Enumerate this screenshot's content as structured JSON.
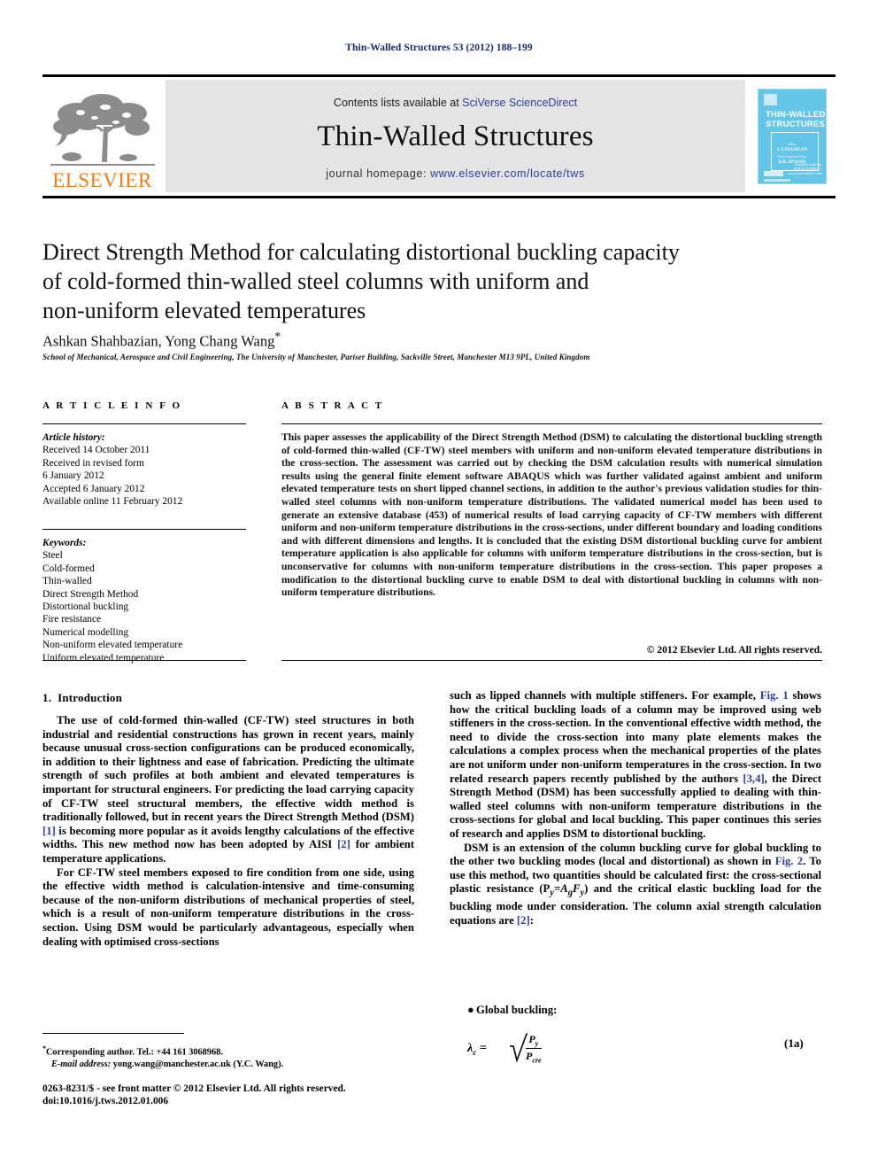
{
  "running_head": "Thin-Walled Structures 53 (2012) 188–199",
  "masthead": {
    "publisher_name": "ELSEVIER",
    "contents_prefix": "Contents lists available at ",
    "contents_link": "SciVerse ScienceDirect",
    "journal_title": "Thin-Walled Structures",
    "homepage_prefix": "journal homepage: ",
    "homepage_url": "www.elsevier.com/locate/tws",
    "cover": {
      "line1": "THIN-WALLED",
      "line2": "STRUCTURES",
      "editor_label": "Editor",
      "editor_name": "J. LOUGHLAN",
      "assoc_label": "North American Editor",
      "assoc_name": "R.B. SPOONS",
      "footer_note": "Available online at",
      "footer_brand": "SCIENCEDIRECT",
      "footer_url": "www.sciencedirect.com"
    },
    "colors": {
      "link": "#2c3fa0",
      "brand_orange": "#ef7d1a",
      "band": "#e4e4e4",
      "cover_blue": "#63c5e8"
    }
  },
  "article": {
    "title_line1": "Direct Strength Method for calculating distortional buckling capacity",
    "title_line2": "of cold-formed thin-walled steel columns with uniform and",
    "title_line3": "non-uniform elevated temperatures",
    "authors": "Ashkan Shahbazian, Yong Chang Wang",
    "author_marker": "*",
    "affiliation": "School of Mechanical, Aerospace and Civil Engineering, The University of Manchester, Pariser Building, Sackville Street, Manchester M13 9PL, United Kingdom"
  },
  "article_info": {
    "heading": "A R T I C L E   I N F O",
    "history_label": "Article history:",
    "history": [
      "Received 14 October 2011",
      "Received in revised form",
      "6 January 2012",
      "Accepted 6 January 2012",
      "Available online 11 February 2012"
    ],
    "keywords_label": "Keywords:",
    "keywords": [
      "Steel",
      "Cold-formed",
      "Thin-walled",
      "Direct Strength Method",
      "Distortional buckling",
      "Fire resistance",
      "Numerical modelling",
      "Non-uniform elevated temperature",
      "Uniform elevated temperature"
    ]
  },
  "abstract": {
    "heading": "A B S T R A C T",
    "text": "This paper assesses the applicability of the Direct Strength Method (DSM) to calculating the distortional buckling strength of cold-formed thin-walled (CF-TW) steel members with uniform and non-uniform elevated temperature distributions in the cross-section. The assessment was carried out by checking the DSM calculation results with numerical simulation results using the general finite element software ABAQUS which was further validated against ambient and uniform elevated temperature tests on short lipped channel sections, in addition to the author's previous validation studies for thin-walled steel columns with non-uniform temperature distributions. The validated numerical model has been used to generate an extensive database (453) of numerical results of load carrying capacity of CF-TW members with different uniform and non-uniform temperature distributions in the cross-sections, under different boundary and loading conditions and with different dimensions and lengths. It is concluded that the existing DSM distortional buckling curve for ambient temperature application is also applicable for columns with uniform temperature distributions in the cross-section, but is unconservative for columns with non-uniform temperature distributions in the cross-section. This paper proposes a modification to the distortional buckling curve to enable DSM to deal with distortional buckling in columns with non-uniform temperature distributions.",
    "copyright": "© 2012 Elsevier Ltd. All rights reserved."
  },
  "body": {
    "section_number": "1.",
    "section_title": "Introduction",
    "left_p1_a": "The use of cold-formed thin-walled (CF-TW) steel structures in both industrial and residential constructions has grown in recent years, mainly because unusual cross-section configurations can be produced economically, in addition to their lightness and ease of fabrication. Predicting the ultimate strength of such profiles at both ambient and elevated temperatures is important for structural engineers. For predicting the load carrying capacity of CF-TW steel structural members, the effective width method is traditionally followed, but in recent years the Direct Strength Method (DSM) ",
    "left_p1_ref1": "[1]",
    "left_p1_b": " is becoming more popular as it avoids lengthy calculations of the effective widths. This new method now has been adopted by AISI ",
    "left_p1_ref2": "[2]",
    "left_p1_c": " for ambient temperature applications.",
    "left_p2": "For CF-TW steel members exposed to fire condition from one side, using the effective width method is calculation-intensive and time-consuming because of the non-uniform distributions of mechanical properties of steel, which is a result of non-uniform temperature distributions in the cross-section. Using DSM would be particularly advantageous, especially when dealing with optimised cross-sections",
    "right_p1_a": "such as lipped channels with multiple stiffeners. For example, ",
    "right_p1_fig1": "Fig. 1",
    "right_p1_b": " shows how the critical buckling loads of a column may be improved using web stiffeners in the cross-section. In the conventional effective width method, the need to divide the cross-section into many plate elements makes the calculations a complex process when the mechanical properties of the plates are not uniform under non-uniform temperatures in the cross-section. In two related research papers recently published by the authors ",
    "right_p1_ref34": "[3,4]",
    "right_p1_c": ", the Direct Strength Method (DSM) has been successfully applied to dealing with thin-walled steel columns with non-uniform temperature distributions in the cross-sections for global and local buckling. This paper continues this series of research and applies DSM to distortional buckling.",
    "right_p2_a": "DSM is an extension of the column buckling curve for global buckling to the other two buckling modes (local and distortional) as shown in ",
    "right_p2_fig2": "Fig. 2",
    "right_p2_b": ". To use this method, two quantities should be calculated first: the cross-sectional plastic resistance (P",
    "right_p2_sub1": "y",
    "right_p2_c": "=A",
    "right_p2_sub2": "g",
    "right_p2_d": "F",
    "right_p2_sub3": "y",
    "right_p2_e": ") and the critical elastic buckling load for the buckling mode under consideration. The column axial strength calculation equations are ",
    "right_p2_ref2": "[2]",
    "right_p2_f": ":",
    "bullet_label": "Global buckling:",
    "equation": {
      "lhs": "λ",
      "lhs_sub": "c",
      "equals": "=",
      "numerator": "P",
      "numerator_sub": "y",
      "denominator": "P",
      "denominator_sub": "cre",
      "number": "(1a)"
    }
  },
  "footnote": {
    "marker": "*",
    "corresponding": "Corresponding author. Tel.: +44 161 3068968.",
    "email_label": "E-mail address:",
    "email": "yong.wang@manchester.ac.uk (Y.C. Wang)."
  },
  "footer": {
    "issn_line": "0263-8231/$ - see front matter © 2012 Elsevier Ltd. All rights reserved.",
    "doi_line": "doi:10.1016/j.tws.2012.01.006"
  }
}
